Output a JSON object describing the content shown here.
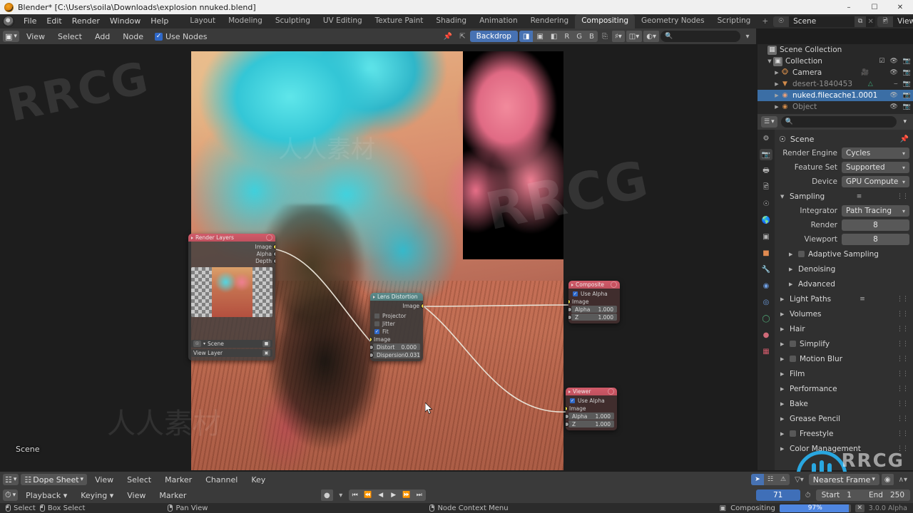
{
  "window": {
    "title": "Blender* [C:\\Users\\soila\\Downloads\\explosion nnuked.blend]",
    "minimize": "–",
    "maximize": "☐",
    "close": "✕",
    "app_icon": "blender-logo-icon"
  },
  "topbar": {
    "menus": [
      "File",
      "Edit",
      "Render",
      "Window",
      "Help"
    ],
    "workspaces": [
      {
        "label": "Layout",
        "active": false
      },
      {
        "label": "Modeling",
        "active": false
      },
      {
        "label": "Sculpting",
        "active": false
      },
      {
        "label": "UV Editing",
        "active": false
      },
      {
        "label": "Texture Paint",
        "active": false
      },
      {
        "label": "Shading",
        "active": false
      },
      {
        "label": "Animation",
        "active": false
      },
      {
        "label": "Rendering",
        "active": false
      },
      {
        "label": "Compositing",
        "active": true
      },
      {
        "label": "Geometry Nodes",
        "active": false
      },
      {
        "label": "Scripting",
        "active": false
      },
      {
        "label": "+",
        "active": false
      }
    ],
    "scene": {
      "name": "Scene",
      "icon": "scene-icon",
      "new_btn": "⧉",
      "unlink_btn": "✕"
    },
    "view_layer": {
      "name": "View Layer",
      "icon": "view-layer-icon",
      "new_btn": "⧉",
      "unlink_btn": "✕"
    }
  },
  "node_header": {
    "editor_type_icon": "compositor-icon",
    "menus": [
      "View",
      "Select",
      "Add",
      "Node"
    ],
    "use_nodes": {
      "label": "Use Nodes",
      "checked": true
    },
    "snap_icon": "snap-pin-icon",
    "up_icon": "move-up-icon",
    "backdrop": {
      "label": "Backdrop",
      "active": true
    },
    "channels": [
      "◨",
      "▣",
      "◧",
      "R",
      "G",
      "B"
    ],
    "channel_active_index": 0,
    "zoom_icon": "zoom-reset-icon",
    "snap_menu_icon": "magnet-icon",
    "overlay_icon": "overlays-icon",
    "gizmo_icon": "gizmo-icon",
    "search_placeholder": "",
    "filter_icon": "filter-icon"
  },
  "node_editor": {
    "scene_label": "Scene",
    "nodes": [
      {
        "id": "render-layers",
        "title": "Render Layers",
        "outputs": [
          "Image",
          "Alpha",
          "Depth"
        ],
        "scene_field": "Scene",
        "layer_field": "View Layer"
      },
      {
        "id": "lens-distortion",
        "title": "Lens Distortion",
        "outputs": [
          "Image"
        ],
        "checkboxes": [
          {
            "label": "Projector",
            "checked": false
          },
          {
            "label": "Jitter",
            "checked": false
          },
          {
            "label": "Fit",
            "checked": true
          }
        ],
        "inputs": [
          "Image"
        ],
        "values": [
          {
            "label": "Distort",
            "value": "0.000"
          },
          {
            "label": "Dispersion",
            "value": "0.031"
          }
        ]
      },
      {
        "id": "composite",
        "title": "Composite",
        "use_alpha": {
          "label": "Use Alpha",
          "checked": true
        },
        "inputs": [
          "Image"
        ],
        "values": [
          {
            "label": "Alpha",
            "value": "1.000"
          },
          {
            "label": "Z",
            "value": "1.000"
          }
        ]
      },
      {
        "id": "viewer",
        "title": "Viewer",
        "use_alpha": {
          "label": "Use Alpha",
          "checked": true
        },
        "inputs": [
          "Image"
        ],
        "values": [
          {
            "label": "Alpha",
            "value": "1.000"
          },
          {
            "label": "Z",
            "value": "1.000"
          }
        ]
      }
    ]
  },
  "outliner": {
    "rows": [
      {
        "indent": 0,
        "tri": "",
        "icon": "scene-collection-icon",
        "label": "Scene Collection",
        "selected": false,
        "dim": false,
        "checkbox": false,
        "eye": false,
        "camera": false
      },
      {
        "indent": 1,
        "tri": "▼",
        "icon": "collection-icon",
        "label": "Collection",
        "selected": false,
        "dim": false,
        "checkbox": true,
        "eye": true,
        "camera": true
      },
      {
        "indent": 2,
        "tri": "▶",
        "icon": "monkey-icon",
        "label": "Camera",
        "selected": false,
        "dim": false,
        "checkbox": false,
        "eye": true,
        "camera": true
      },
      {
        "indent": 2,
        "tri": "▶",
        "icon": "cone-icon",
        "label": "desert-1840453",
        "selected": false,
        "dim": true,
        "checkbox": false,
        "eye": true,
        "camera": true
      },
      {
        "indent": 2,
        "tri": "▶",
        "icon": "fluid-icon",
        "label": "nuked.filecache1.0001",
        "selected": true,
        "dim": false,
        "checkbox": false,
        "eye": true,
        "camera": true
      },
      {
        "indent": 2,
        "tri": "▶",
        "icon": "object-icon",
        "label": "Object",
        "selected": false,
        "dim": true,
        "checkbox": false,
        "eye": true,
        "camera": true
      }
    ],
    "filter": {
      "display_mode_icon": "display-mode-icon",
      "search_placeholder": "",
      "search_icon": "search-icon",
      "expand_icon": "chevron-down-icon"
    }
  },
  "properties": {
    "tabs": [
      {
        "icon": "tool-icon",
        "name": "tool",
        "active": false,
        "color": "#b4b4b4"
      },
      {
        "icon": "render-icon",
        "name": "render",
        "active": true,
        "color": "#e8e8e8"
      },
      {
        "icon": "output-icon",
        "name": "output",
        "active": false,
        "color": "#b4b4b4"
      },
      {
        "icon": "view-layer-icon",
        "name": "view-layer",
        "active": false,
        "color": "#b4b4b4"
      },
      {
        "icon": "scene-icon",
        "name": "scene",
        "active": false,
        "color": "#b4b4b4"
      },
      {
        "icon": "world-icon",
        "name": "world",
        "active": false,
        "color": "#d06a78"
      },
      {
        "icon": "collection-icon",
        "name": "collection",
        "active": false,
        "color": "#b4b4b4"
      },
      {
        "icon": "object-icon",
        "name": "object",
        "active": false,
        "color": "#e08a50"
      },
      {
        "icon": "modifier-icon",
        "name": "modifiers",
        "active": false,
        "color": "#5a8ed8"
      },
      {
        "icon": "particles-icon",
        "name": "particles",
        "active": false,
        "color": "#6d9de0"
      },
      {
        "icon": "physics-icon",
        "name": "physics",
        "active": false,
        "color": "#6d9de0"
      },
      {
        "icon": "constraints-icon",
        "name": "constraints",
        "active": false,
        "color": "#52b07a"
      },
      {
        "icon": "material-icon",
        "name": "material",
        "active": false,
        "color": "#d06a78"
      },
      {
        "icon": "texture-icon",
        "name": "texture",
        "active": false,
        "color": "#d05a6a"
      }
    ],
    "breadcrumb": {
      "icon": "scene-icon",
      "label": "Scene",
      "pin_icon": "pin-icon"
    },
    "fields": [
      {
        "label": "Render Engine",
        "value": "Cycles"
      },
      {
        "label": "Feature Set",
        "value": "Supported"
      },
      {
        "label": "Device",
        "value": "GPU Compute"
      }
    ],
    "sampling": {
      "title": "Sampling",
      "open": true,
      "integrator": {
        "label": "Integrator",
        "value": "Path Tracing"
      },
      "render": {
        "label": "Render",
        "value": "8"
      },
      "viewport": {
        "label": "Viewport",
        "value": "8"
      },
      "sub_sections": [
        {
          "label": "Adaptive Sampling",
          "checkbox": true
        },
        {
          "label": "Denoising",
          "checkbox": false
        },
        {
          "label": "Advanced",
          "checkbox": false
        }
      ]
    },
    "sections": [
      {
        "label": "Light Paths",
        "checkbox": false,
        "list": true
      },
      {
        "label": "Volumes",
        "checkbox": false,
        "list": false
      },
      {
        "label": "Hair",
        "checkbox": false,
        "list": false
      },
      {
        "label": "Simplify",
        "checkbox": true,
        "list": false
      },
      {
        "label": "Motion Blur",
        "checkbox": true,
        "list": false
      },
      {
        "label": "Film",
        "checkbox": false,
        "list": false
      },
      {
        "label": "Performance",
        "checkbox": false,
        "list": false
      },
      {
        "label": "Bake",
        "checkbox": false,
        "list": false
      },
      {
        "label": "Grease Pencil",
        "checkbox": false,
        "list": false
      },
      {
        "label": "Freestyle",
        "checkbox": true,
        "list": false
      },
      {
        "label": "Color Management",
        "checkbox": false,
        "list": false
      }
    ]
  },
  "dope_sheet": {
    "editor_icon": "dope-sheet-icon",
    "mode": "Dope Sheet",
    "menus": [
      "View",
      "Select",
      "Marker",
      "Channel",
      "Key"
    ],
    "tools": [
      "➤",
      "⬚",
      "⚠"
    ],
    "filter_icon": "filter-icon",
    "snap_mode": "Nearest Frame",
    "proportional_icon": "proportional-edit-icon",
    "falloff_icon": "falloff-icon"
  },
  "timeline": {
    "editor_icon": "timeline-icon",
    "menus_dd": [
      "Playback",
      "Keying"
    ],
    "menus": [
      "View",
      "Marker"
    ],
    "record_icon": "record-icon",
    "transport": [
      "⏮",
      "⏪",
      "◀",
      "▶",
      "⏩",
      "⏭"
    ],
    "current_frame": "71",
    "clock_icon": "auto-key-icon",
    "start_label": "Start",
    "start_value": "1",
    "end_label": "End",
    "end_value": "250"
  },
  "status_bar": {
    "hints": [
      {
        "mouse": "left",
        "label": "Select"
      },
      {
        "mouse": "left-drag",
        "label": "Box Select"
      },
      {
        "mouse": "middle",
        "label": "Pan View"
      },
      {
        "mouse": "right",
        "label": "Node Context Menu"
      }
    ],
    "job": {
      "icon": "compositing-icon",
      "label": "Compositing",
      "progress": "97%",
      "progress_pct": 97,
      "cancel": "✕"
    },
    "version": "3.0.0 Alpha"
  },
  "colors": {
    "accent_blue": "#4772b3",
    "node_header_red": "#c0515f",
    "node_header_teal": "#4f7b7b",
    "socket_image": "#f0e24b",
    "selected_row": "#3b6ea5",
    "progress_blue": "#4f86e0"
  }
}
